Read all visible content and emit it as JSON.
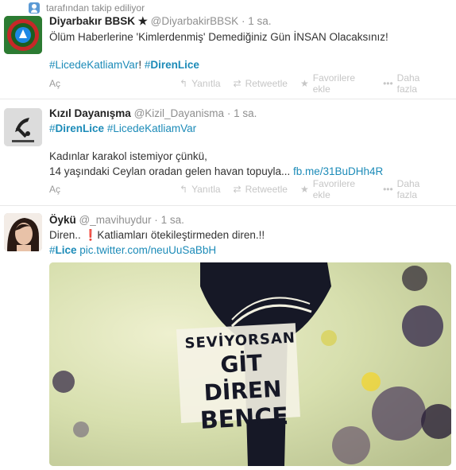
{
  "context": {
    "text": "tarafından takip ediliyor"
  },
  "actions": {
    "reply": "Yanıtla",
    "retweet": "Retweetle",
    "favorite": "Favorilere ekle",
    "more": "Daha fazla",
    "open": "Aç"
  },
  "tweets": [
    {
      "name": "Diyarbakır BBSK ★",
      "handle": "@DiyarbakirBBSK",
      "time": "1 sa.",
      "line1": "Ölüm Haberlerine 'Kimlerdenmiş' Demediğiniz Gün İNSAN Olacaksınız!",
      "tag1": "#LicedeKatliamVar",
      "sep": "! ",
      "tag2_hash": "#",
      "tag2_word": "DirenLice"
    },
    {
      "name": "Kızıl Dayanışma",
      "handle": "@Kizil_Dayanisma",
      "time": "1 sa.",
      "tag_a_hash": "#",
      "tag_a_word": "DirenLice",
      "tag_b": "#LicedeKatliamVar",
      "line2": "Kadınlar karakol istemiyor çünkü,",
      "line3": "14 yaşındaki Ceylan oradan gelen havan topuyla...",
      "link": "fb.me/31BuDHh4R"
    },
    {
      "name": "Öykü",
      "handle": "@_mavihuydur",
      "time": "1 sa.",
      "line1_a": "Diren..",
      "line1_emoji": "❗",
      "line1_b": "Katliamları ötekileştirmeden diren.!!",
      "tag_hash": "#",
      "tag_word": "Lice",
      "link": "pic.twitter.com/neuUuSaBbH",
      "photo_text": [
        "SEVİYORSAN",
        "GİT DİREN",
        "BENCE"
      ]
    }
  ]
}
